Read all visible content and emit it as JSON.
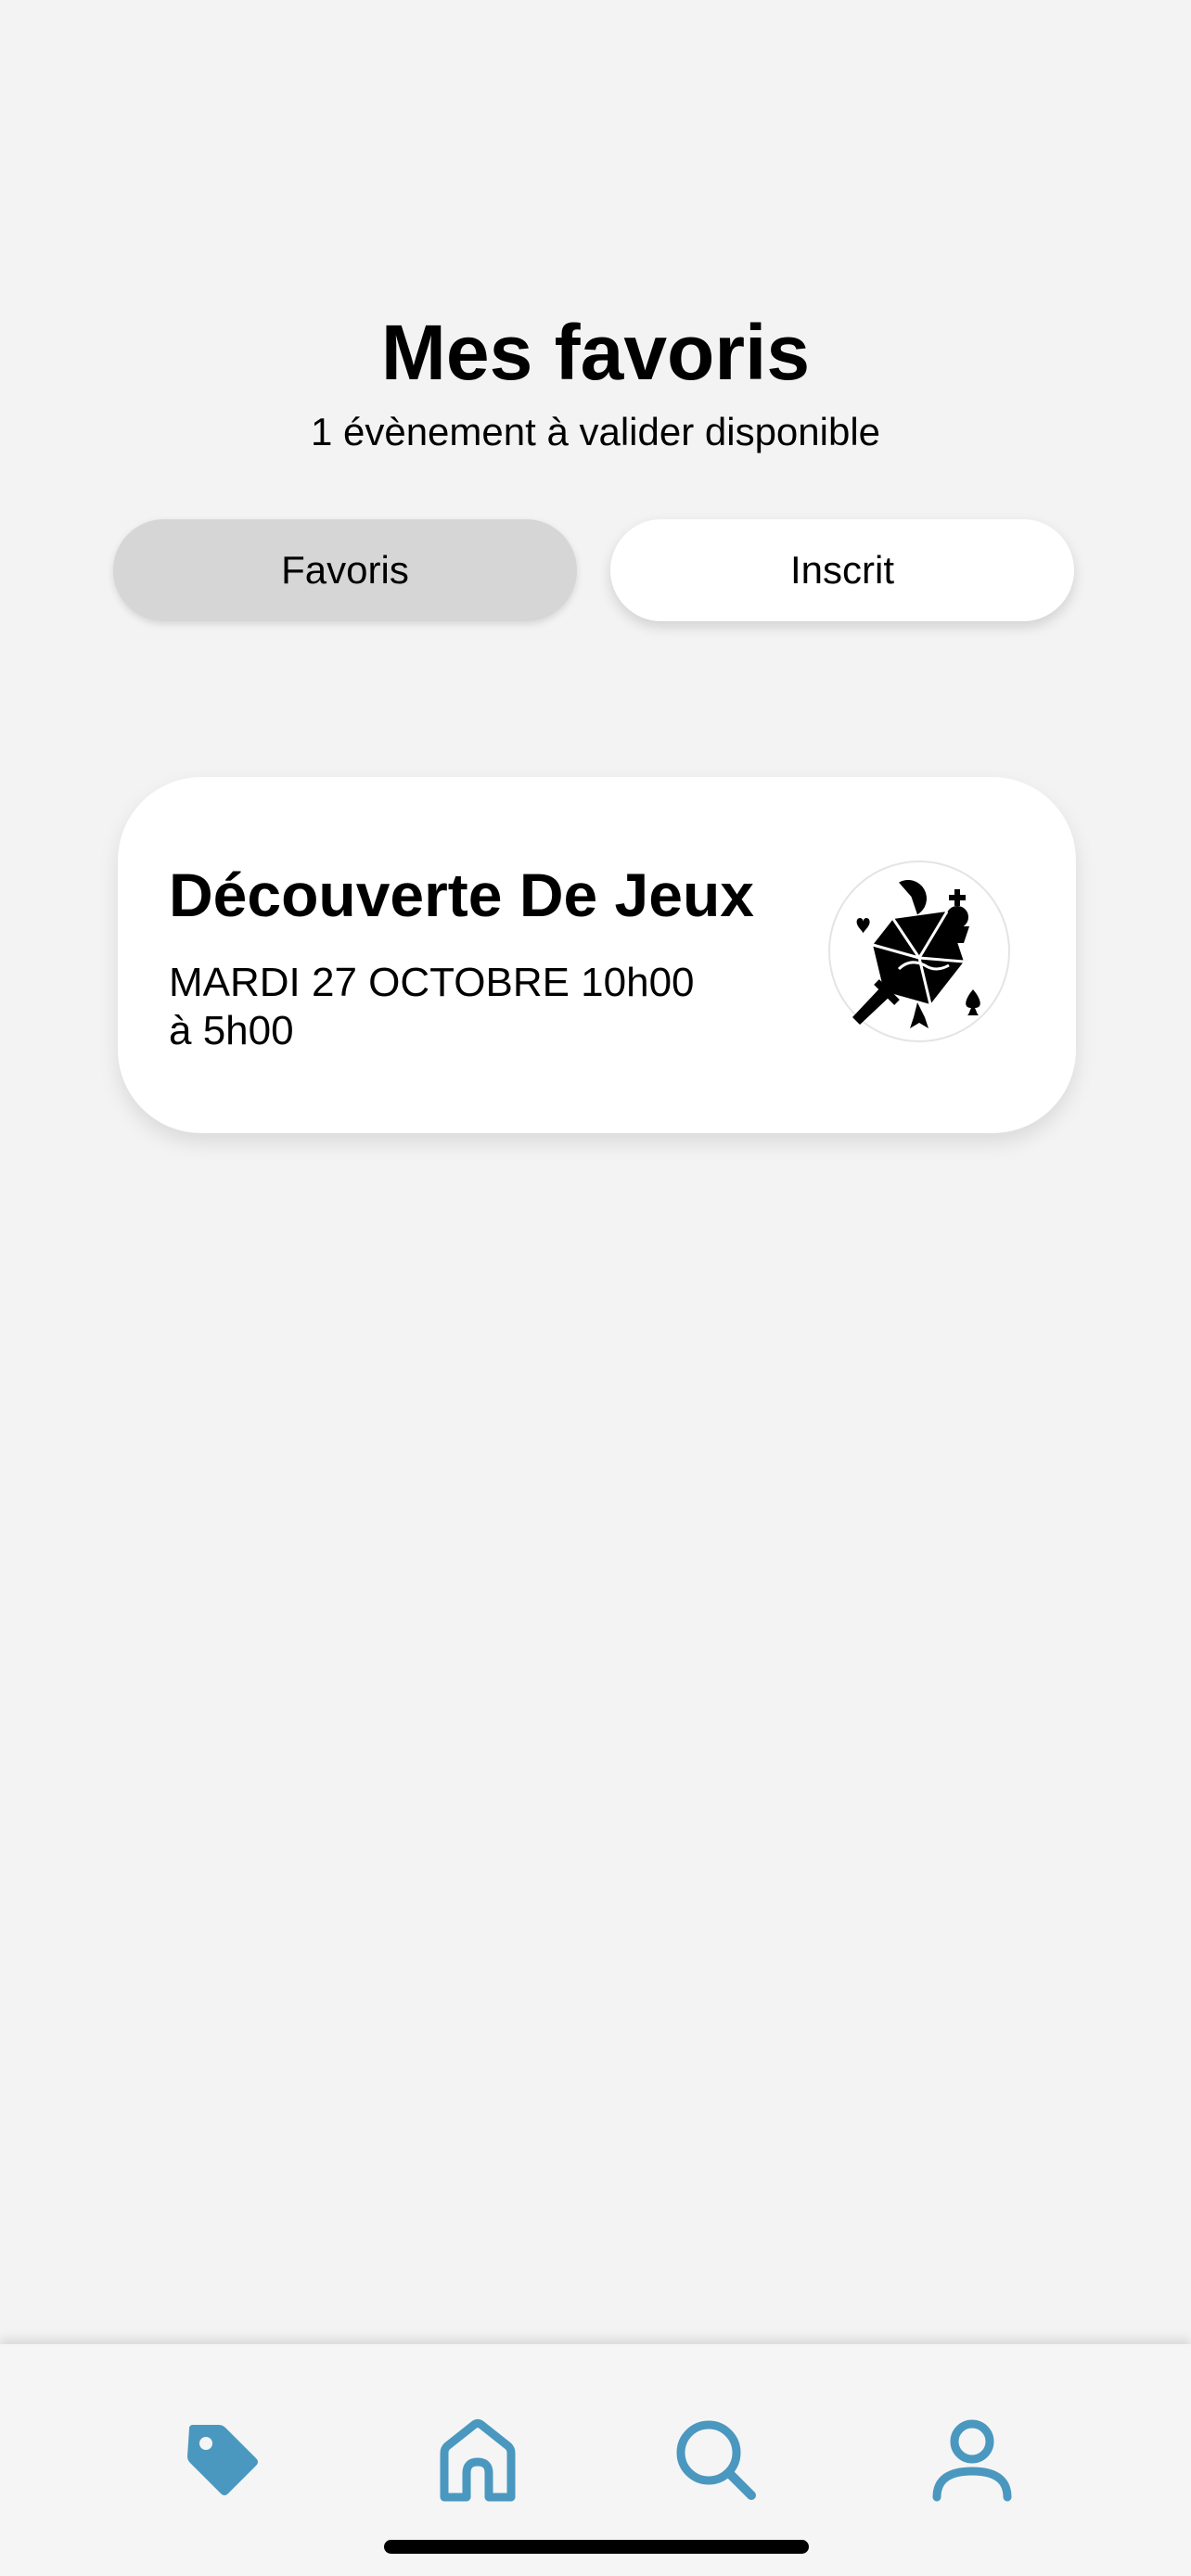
{
  "header": {
    "title": "Mes favoris",
    "subtitle": "1 évènement à valider disponible"
  },
  "tabs": [
    {
      "label": "Favoris",
      "active": true
    },
    {
      "label": "Inscrit",
      "active": false
    }
  ],
  "events": [
    {
      "title": "Découverte De Jeux",
      "date_line1": "MARDI 27 OCTOBRE 10h00",
      "date_line2": "à 5h00",
      "icon": "game-logo-icon"
    }
  ],
  "bottom_nav": {
    "accent_color": "#4a98bf",
    "items": [
      {
        "icon": "tag-icon"
      },
      {
        "icon": "home-icon"
      },
      {
        "icon": "search-icon"
      },
      {
        "icon": "user-icon"
      }
    ]
  }
}
